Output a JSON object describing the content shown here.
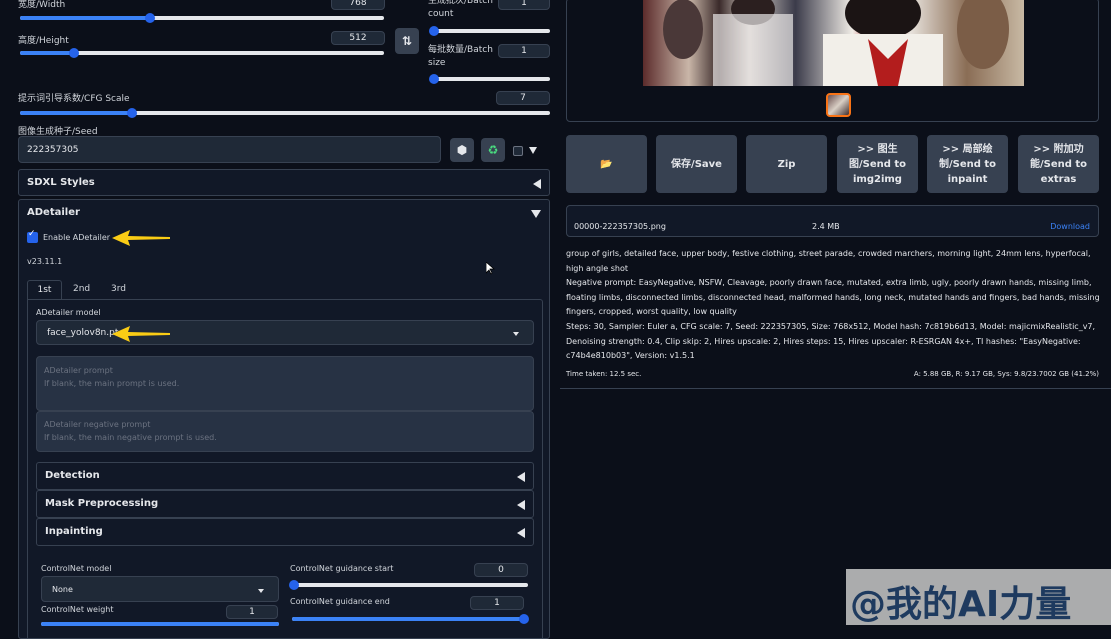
{
  "left": {
    "width": {
      "label": "宽度/Width",
      "value": "768"
    },
    "height": {
      "label": "高度/Height",
      "value": "512"
    },
    "batch_count": {
      "label1": "生成批次/Batch",
      "label2": "count",
      "value": "1"
    },
    "batch_size": {
      "label1": "每批数量/Batch",
      "label2": "size",
      "value": "1"
    },
    "cfg": {
      "label": "提示词引导系数/CFG Scale",
      "value": "7"
    },
    "seed": {
      "label": "图像生成种子/Seed",
      "value": "222357305"
    },
    "sdxl_styles": "SDXL Styles",
    "adetailer": {
      "title": "ADetailer",
      "enable_label": "Enable ADetailer",
      "version": "v23.11.1",
      "tabs": [
        "1st",
        "2nd",
        "3rd"
      ],
      "model_label": "ADetailer model",
      "model_value": "face_yolov8n.pt",
      "prompt_label": "ADetailer prompt",
      "prompt_placeholder": "If blank, the main prompt is used.",
      "neg_label": "ADetailer negative prompt",
      "neg_placeholder": "If blank, the main negative prompt is used.",
      "sections": [
        "Detection",
        "Mask Preprocessing",
        "Inpainting"
      ],
      "controlnet_model_label": "ControlNet model",
      "controlnet_model_value": "None",
      "controlnet_weight_label": "ControlNet weight",
      "controlnet_weight_value": "1",
      "guidance_start_label": "ControlNet guidance start",
      "guidance_start_value": "0",
      "guidance_end_label": "ControlNet guidance end",
      "guidance_end_value": "1"
    }
  },
  "right": {
    "buttons": [
      {
        "label": "📂"
      },
      {
        "label": "保存/Save"
      },
      {
        "label": "Zip"
      },
      {
        "label": ">> 图生图/Send to img2img"
      },
      {
        "label": ">> 局部绘制/Send to inpaint"
      },
      {
        "label": ">> 附加功能/Send to extras"
      }
    ],
    "file": {
      "name": "00000-222357305.png",
      "size": "2.4 MB",
      "download": "Download"
    },
    "prompt": "group of girls, detailed face, upper body, festive clothing, street parade, crowded marchers, morning light, 24mm lens, hyperfocal, high angle shot",
    "negative": "Negative prompt: EasyNegative, NSFW, Cleavage, poorly drawn face, mutated, extra limb, ugly, poorly drawn hands, missing limb, floating limbs, disconnected limbs, disconnected head, malformed hands, long neck, mutated hands and fingers, bad hands, missing fingers, cropped, worst quality, low quality",
    "params": "Steps: 30, Sampler: Euler a, CFG scale: 7, Seed: 222357305, Size: 768x512, Model hash: 7c819b6d13, Model: majicmixRealistic_v7, Denoising strength: 0.4, Clip skip: 2, Hires upscale: 2, Hires steps: 15, Hires upscaler: R-ESRGAN 4x+, TI hashes: \"EasyNegative: c74b4e810b03\", Version: v1.5.1",
    "time": "Time taken: 12.5 sec.",
    "vram": "A: 5.88 GB, R: 9.17 GB, Sys: 9.8/23.7002 GB (41.2%)"
  },
  "watermark": "@我的AI力量",
  "colors": {
    "accent": "#2563eb",
    "arrow": "#facc15",
    "thumb_border": "#f97316",
    "download": "#3b82f6"
  }
}
